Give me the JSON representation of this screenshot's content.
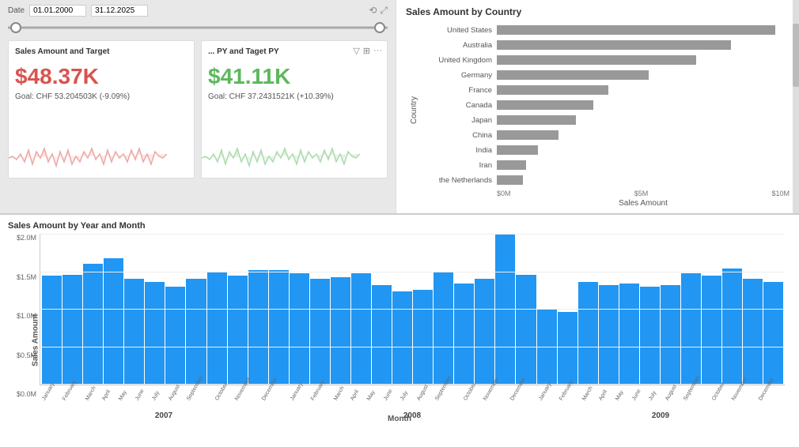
{
  "header": {
    "date_label": "Date",
    "date_start": "01.01.2000",
    "date_end": "31.12.2025"
  },
  "cards": {
    "card1": {
      "title": "Sales Amount and Target",
      "kpi_value": "$48.37K",
      "kpi_color": "red",
      "goal_text": "Goal: CHF 53.204503K (-9.09%)"
    },
    "card2": {
      "title": "... PY and Taget PY",
      "kpi_value": "$41.11K",
      "kpi_color": "green",
      "goal_text": "Goal: CHF 37.2431521K (+10.39%)"
    }
  },
  "bar_chart": {
    "title": "Sales Amount by Country",
    "x_axis_label": "Sales Amount",
    "y_axis_label": "Country",
    "axis_ticks": [
      "$0M",
      "$5M",
      "$10M"
    ],
    "countries": [
      {
        "name": "United States",
        "pct": 95
      },
      {
        "name": "Australia",
        "pct": 80
      },
      {
        "name": "United Kingdom",
        "pct": 68
      },
      {
        "name": "Germany",
        "pct": 52
      },
      {
        "name": "France",
        "pct": 38
      },
      {
        "name": "Canada",
        "pct": 33
      },
      {
        "name": "Japan",
        "pct": 27
      },
      {
        "name": "China",
        "pct": 21
      },
      {
        "name": "India",
        "pct": 14
      },
      {
        "name": "Iran",
        "pct": 10
      },
      {
        "name": "the Netherlands",
        "pct": 9
      }
    ]
  },
  "column_chart": {
    "title": "Sales Amount by Year and Month",
    "x_axis_title": "Month",
    "y_axis_title": "Sales Amount",
    "y_ticks": [
      "$2.0M",
      "$1.5M",
      "$1.0M",
      "$0.5M",
      "$0.0M"
    ],
    "years": [
      "2007",
      "2008",
      "2009"
    ],
    "months": [
      "January",
      "February",
      "March",
      "April",
      "May",
      "June",
      "July",
      "August",
      "September",
      "October",
      "November",
      "December"
    ],
    "bars_2007": [
      72,
      73,
      80,
      84,
      70,
      68,
      65,
      70,
      75,
      72,
      76,
      76
    ],
    "bars_2008": [
      74,
      70,
      71,
      74,
      66,
      62,
      63,
      75,
      67,
      70,
      100,
      73
    ],
    "bars_2009": [
      50,
      48,
      68,
      66,
      67,
      65,
      66,
      74,
      72,
      77,
      70,
      68
    ]
  }
}
